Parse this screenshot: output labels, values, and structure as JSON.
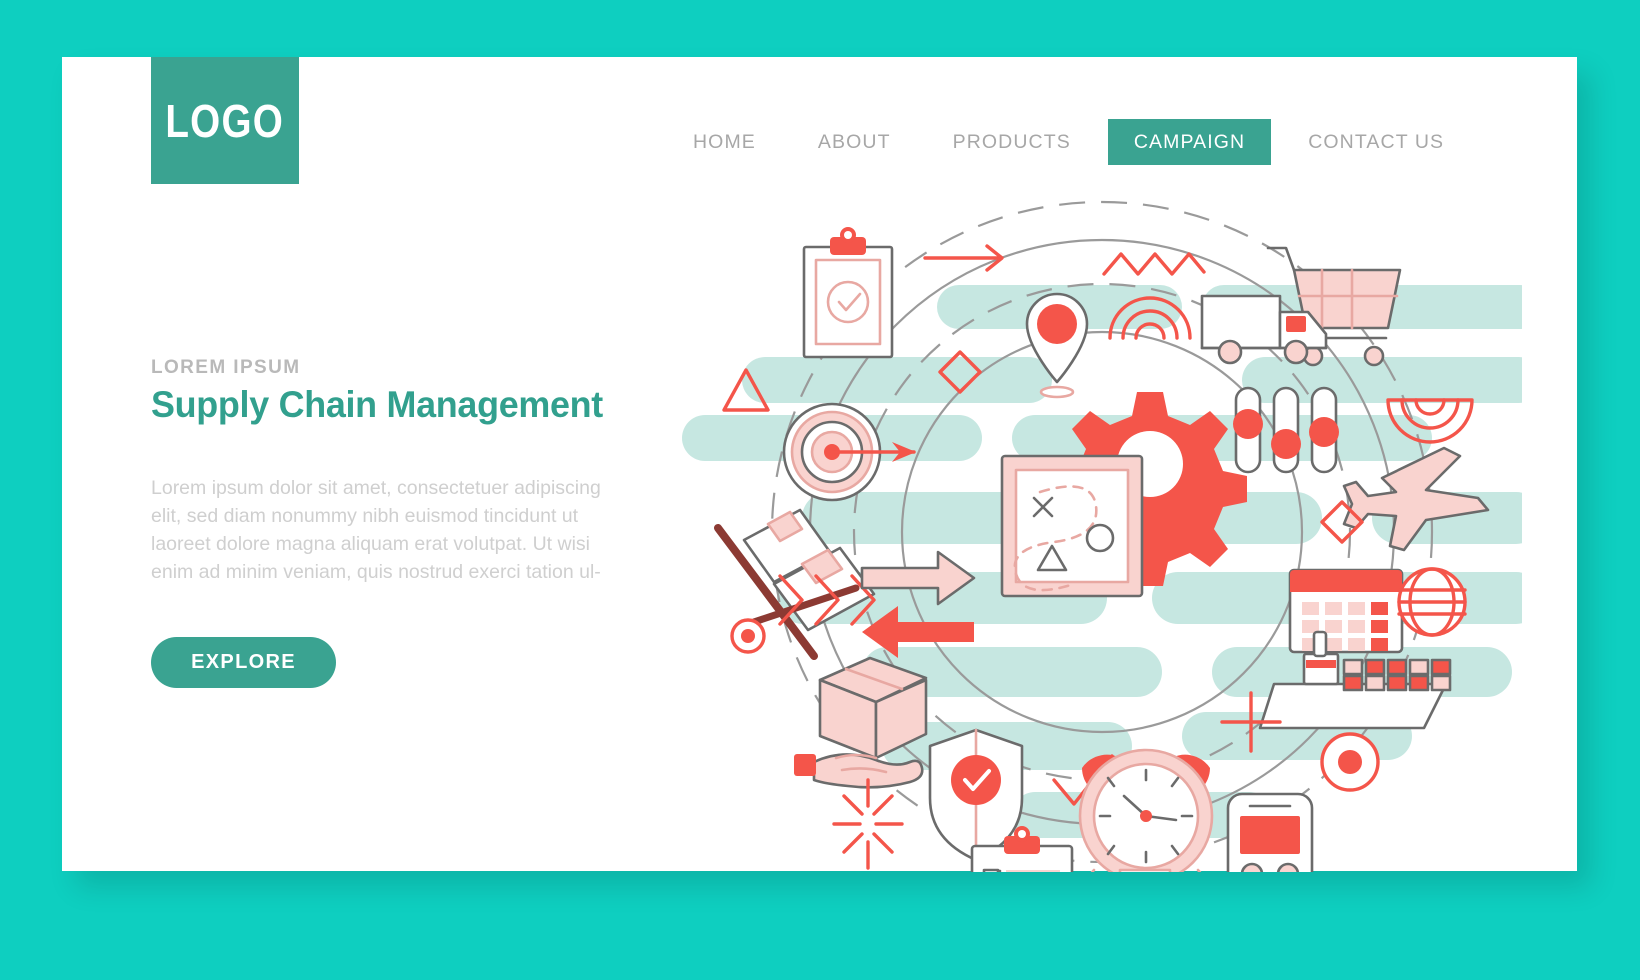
{
  "page": {
    "background_color": "#0ecfc0",
    "card_background": "#ffffff"
  },
  "colors": {
    "turquoise": "#0ecfc0",
    "teal": "#3aa391",
    "heading_teal": "#32a08e",
    "coral": "#f4554a",
    "light_coral": "#f9d3cf",
    "mint": "#c6e7e1",
    "gray_text": "#cfcfcf",
    "nav_gray": "#a7a7a7",
    "line_gray": "#9a9a9a"
  },
  "header": {
    "logo_label": "LOGO",
    "nav": [
      {
        "label": "HOME",
        "active": false
      },
      {
        "label": "ABOUT",
        "active": false
      },
      {
        "label": "PRODUCTS",
        "active": false
      },
      {
        "label": "CAMPAIGN",
        "active": true
      },
      {
        "label": "CONTACT US",
        "active": false
      }
    ]
  },
  "hero": {
    "eyebrow": "LOREM IPSUM",
    "title": "Supply Chain Management",
    "paragraph": "Lorem ipsum dolor sit amet, consectetuer adipiscing elit, sed diam nonummy nibh euismod tincidunt ut laoreet dolore magna aliquam erat volutpat. Ut wisi enim ad minim veniam, quis nostrud exerci tation ul-",
    "cta_label": "EXPLORE"
  },
  "illustration": {
    "description": "Circular supply chain icon composition",
    "orbit_rings": 4,
    "icons": [
      "clipboard-check-icon",
      "arrow-right-icon",
      "zigzag-icon",
      "shopping-cart-icon",
      "map-pin-icon",
      "radar-arc-icon",
      "delivery-truck-icon",
      "radial-signal-icon",
      "slider-controls-icon",
      "airplane-icon",
      "triangle-icon",
      "diamond-icon",
      "dartboard-target-icon",
      "hand-truck-icon",
      "wave-icon",
      "chevrons-right-icon",
      "arrow-exchange-icon",
      "gear-icon",
      "strategy-board-icon",
      "calendar-icon",
      "globe-grid-icon",
      "cargo-ship-icon",
      "plus-icon",
      "bullseye-dot-icon",
      "package-box-icon",
      "hand-delivery-icon",
      "shield-check-icon",
      "starburst-icon",
      "checkmark-icon",
      "alarm-clock-icon",
      "checklist-clipboard-icon",
      "train-icon",
      "square-outline-icon"
    ]
  }
}
